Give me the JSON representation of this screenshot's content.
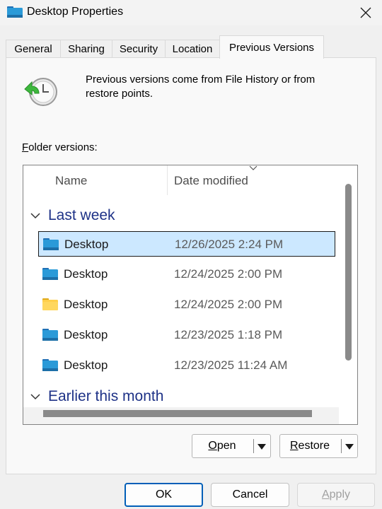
{
  "window": {
    "title": "Desktop Properties"
  },
  "tabs": [
    {
      "label": "General"
    },
    {
      "label": "Sharing"
    },
    {
      "label": "Security"
    },
    {
      "label": "Location"
    },
    {
      "label": "Previous Versions"
    }
  ],
  "info": {
    "text": "Previous versions come from File History or from restore points."
  },
  "list": {
    "label_first": "F",
    "label_rest": "older versions:",
    "columns": {
      "name": "Name",
      "date": "Date modified"
    },
    "groups": [
      {
        "title": "Last week",
        "items": [
          {
            "name": "Desktop",
            "date": "12/26/2025 2:24 PM",
            "icon": "desktop-folder-icon",
            "selected": true
          },
          {
            "name": "Desktop",
            "date": "12/24/2025 2:00 PM",
            "icon": "desktop-folder-icon",
            "selected": false
          },
          {
            "name": "Desktop",
            "date": "12/24/2025 2:00 PM",
            "icon": "yellow-folder-icon",
            "selected": false
          },
          {
            "name": "Desktop",
            "date": "12/23/2025 1:18 PM",
            "icon": "desktop-folder-icon",
            "selected": false
          },
          {
            "name": "Desktop",
            "date": "12/23/2025 11:24 AM",
            "icon": "desktop-folder-icon",
            "selected": false
          }
        ]
      },
      {
        "title": "Earlier this month",
        "items": []
      }
    ]
  },
  "actions": {
    "open_first": "O",
    "open_rest": "pen",
    "restore_first": "R",
    "restore_rest": "estore"
  },
  "footer": {
    "ok": "OK",
    "cancel": "Cancel",
    "apply_first": "A",
    "apply_rest": "pply"
  },
  "colors": {
    "accent": "#005fb8",
    "selection": "#cce8ff",
    "group_header": "#1e3287"
  }
}
